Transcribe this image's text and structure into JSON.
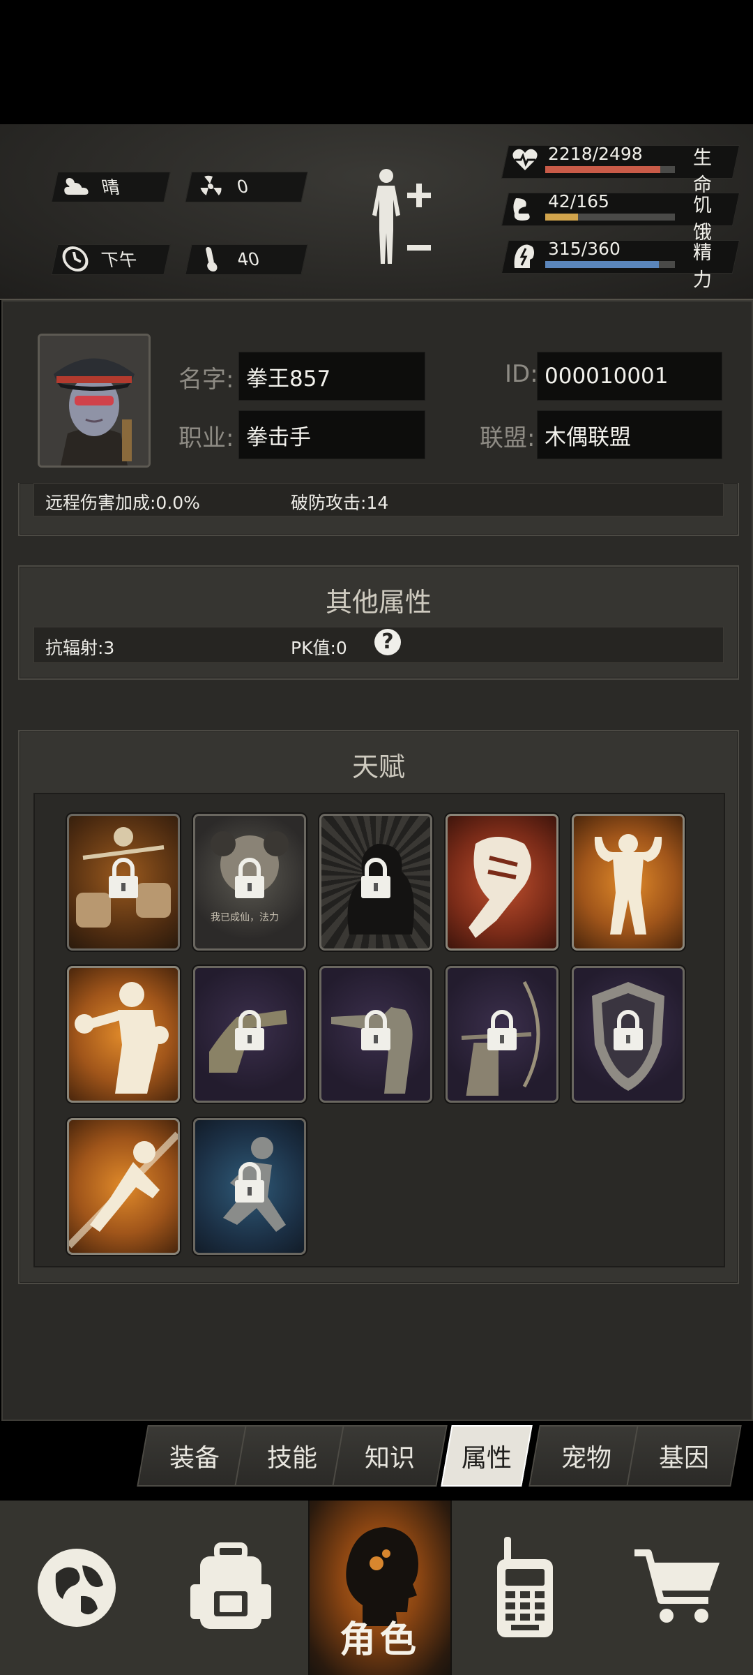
{
  "hud": {
    "weather": "晴",
    "radiation": "0",
    "time_of_day": "下午",
    "temperature": "40",
    "stats": [
      {
        "value": "2218/2498",
        "name": "生命",
        "fraction": 0.888,
        "color": "#c95b48"
      },
      {
        "value": "42/165",
        "name": "饥饿",
        "fraction": 0.255,
        "color": "#d1a44c"
      },
      {
        "value": "315/360",
        "name": "精力",
        "fraction": 0.875,
        "color": "#5b86bb"
      }
    ]
  },
  "profile": {
    "name_label": "名字:",
    "name_value": "拳王857",
    "id_label": "ID:",
    "id_value": "000010001",
    "job_label": "职业:",
    "job_value": "拳击手",
    "alliance_label": "联盟:",
    "alliance_value": "木偶联盟"
  },
  "attack_row": {
    "ranged_bonus": "远程伤害加成:0.0%",
    "armor_break": "破防攻击:14"
  },
  "other_attrs": {
    "title": "其他属性",
    "radiation_resist": "抗辐射:3",
    "pk_value": "PK值:0"
  },
  "talents": {
    "title": "天赋",
    "locked_caption": "我已成仙，法力"
  },
  "sub_tabs": [
    "装备",
    "技能",
    "知识",
    "属性",
    "宠物",
    "基因"
  ],
  "sub_tab_selected": "属性",
  "nav": {
    "role_label": "角色"
  },
  "colors": {
    "accent_orange": "#c06a1e",
    "health": "#c95b48",
    "hunger": "#d1a44c",
    "energy": "#5b86bb"
  }
}
